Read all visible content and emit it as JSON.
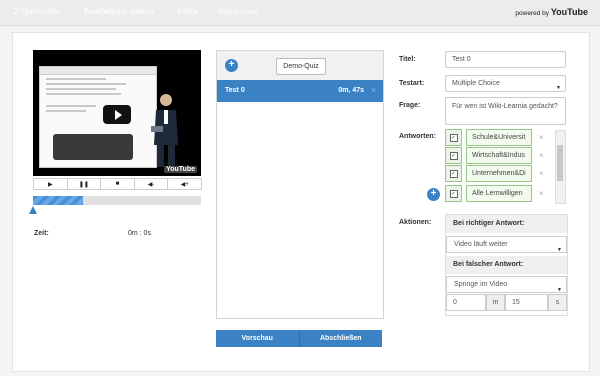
{
  "nav": {
    "items": [
      {
        "label": "Z-Quizmaker"
      },
      {
        "label": "Bearbeitung starten"
      },
      {
        "label": "Editor"
      },
      {
        "label": "Impressum"
      }
    ]
  },
  "brand": {
    "powered_by": "powered by",
    "logo_text": "YouTube"
  },
  "video": {
    "watermark": "YouTube",
    "progress_fraction": 0.3
  },
  "controls": {
    "icons": [
      "play-icon",
      "pause-icon",
      "stop-icon",
      "volume-down-icon",
      "volume-up-icon"
    ]
  },
  "time": {
    "label": "Zeit:",
    "value": "0m : 0s"
  },
  "quizlist": {
    "add_label": "+",
    "demo_button": "Demo-Quiz",
    "items": [
      {
        "title": "Test 0",
        "time": "0m, 47s",
        "delete": "×"
      }
    ]
  },
  "footer_buttons": {
    "preview": "Vorschau",
    "finish": "Abschließen"
  },
  "form": {
    "title_label": "Titel:",
    "title_value": "Test 0",
    "type_label": "Testart:",
    "type_value": "Multiple Choice",
    "question_label": "Frage:",
    "question_value": "Für wen ist Wiki-Learnia gedacht?",
    "answers_label": "Antworten:",
    "answers": [
      {
        "text": "Schule&Universit",
        "checked": true
      },
      {
        "text": "Wirtschaft&Indus",
        "checked": true
      },
      {
        "text": "Unternehmen&Di",
        "checked": true
      },
      {
        "text": "Alle Lernwilligen",
        "checked": true
      }
    ],
    "answer_delete": "×",
    "answer_add": "+",
    "actions_label": "Aktionen:",
    "correct_header": "Bei richtiger Antwort:",
    "correct_value": "Video läuft weiter",
    "wrong_header": "Bei falscher Antwort:",
    "wrong_value": "Springe im Video",
    "jump_minutes": "0",
    "minutes_unit": "m",
    "jump_seconds": "15",
    "seconds_unit": "s"
  },
  "colors": {
    "accent": "#3b82c4",
    "answer_border": "#9ac58a"
  }
}
